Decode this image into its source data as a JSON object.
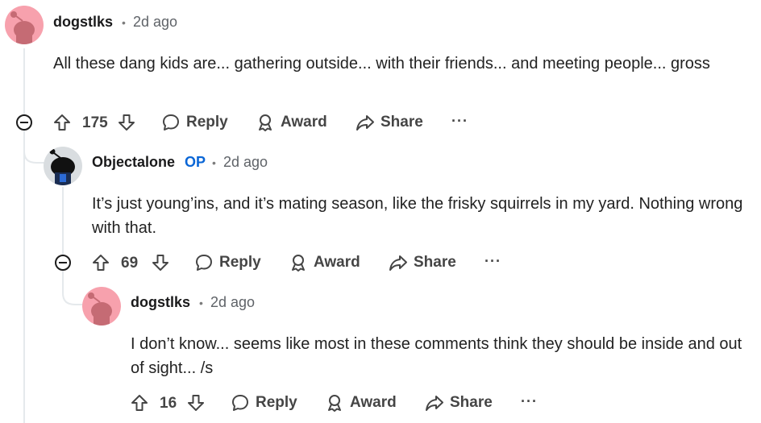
{
  "comments": [
    {
      "username": "dogstlks",
      "op_badge": "",
      "dot": "•",
      "time": "2d ago",
      "body": "All these dang kids are... gathering outside... with their friends... and meeting people... gross",
      "votes": "175",
      "reply": "Reply",
      "award": "Award",
      "share": "Share",
      "more": "···"
    },
    {
      "username": "Objectalone",
      "op_badge": "OP",
      "dot": "•",
      "time": "2d ago",
      "body": "It’s just young’ins, and it’s mating season, like the frisky squirrels in my yard. Nothing wrong with that.",
      "votes": "69",
      "reply": "Reply",
      "award": "Award",
      "share": "Share",
      "more": "···"
    },
    {
      "username": "dogstlks",
      "op_badge": "",
      "dot": "•",
      "time": "2d ago",
      "body": "I don’t know... seems like most in these comments think they should be inside and out of sight... /s",
      "votes": "16",
      "reply": "Reply",
      "award": "Award",
      "share": "Share",
      "more": "···"
    }
  ],
  "colors": {
    "avatar_pink": "#f7a1ad",
    "op_blue": "#0a66d6",
    "thread_line": "#e5e9ec"
  }
}
